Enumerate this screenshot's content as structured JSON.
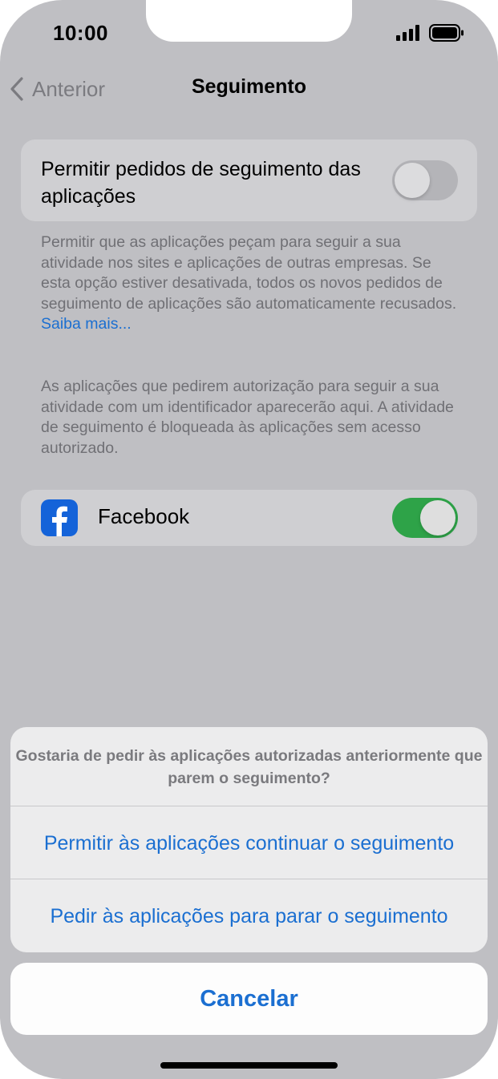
{
  "status_bar": {
    "time": "10:00"
  },
  "nav": {
    "back_label": "Anterior",
    "title": "Seguimento"
  },
  "tracking_toggle": {
    "label": "Permitir pedidos de seguimento das aplicações",
    "on": false
  },
  "description_1": {
    "text": "Permitir que as aplicações peçam para seguir a sua atividade nos sites e aplicações de outras empresas. Se esta opção estiver desativada, todos os novos pedidos de seguimento de aplicações são automaticamente recusados. ",
    "link": "Saiba mais..."
  },
  "description_2": "As aplicações que pedirem autorização para seguir a sua atividade com um identificador aparecerão aqui. A atividade de seguimento é bloqueada às aplicações sem acesso autorizado.",
  "apps": [
    {
      "name": "Facebook",
      "icon": "facebook-icon",
      "tracking_on": true
    }
  ],
  "action_sheet": {
    "message": "Gostaria de pedir às aplicações autorizadas anteriormente que parem o seguimento?",
    "actions": [
      "Permitir às aplicações continuar o seguimento",
      "Pedir às aplicações para parar o seguimento"
    ],
    "cancel": "Cancelar"
  },
  "colors": {
    "accent": "#1b6fd1",
    "toggle_on": "#2ea348",
    "facebook_blue": "#1463d9"
  }
}
